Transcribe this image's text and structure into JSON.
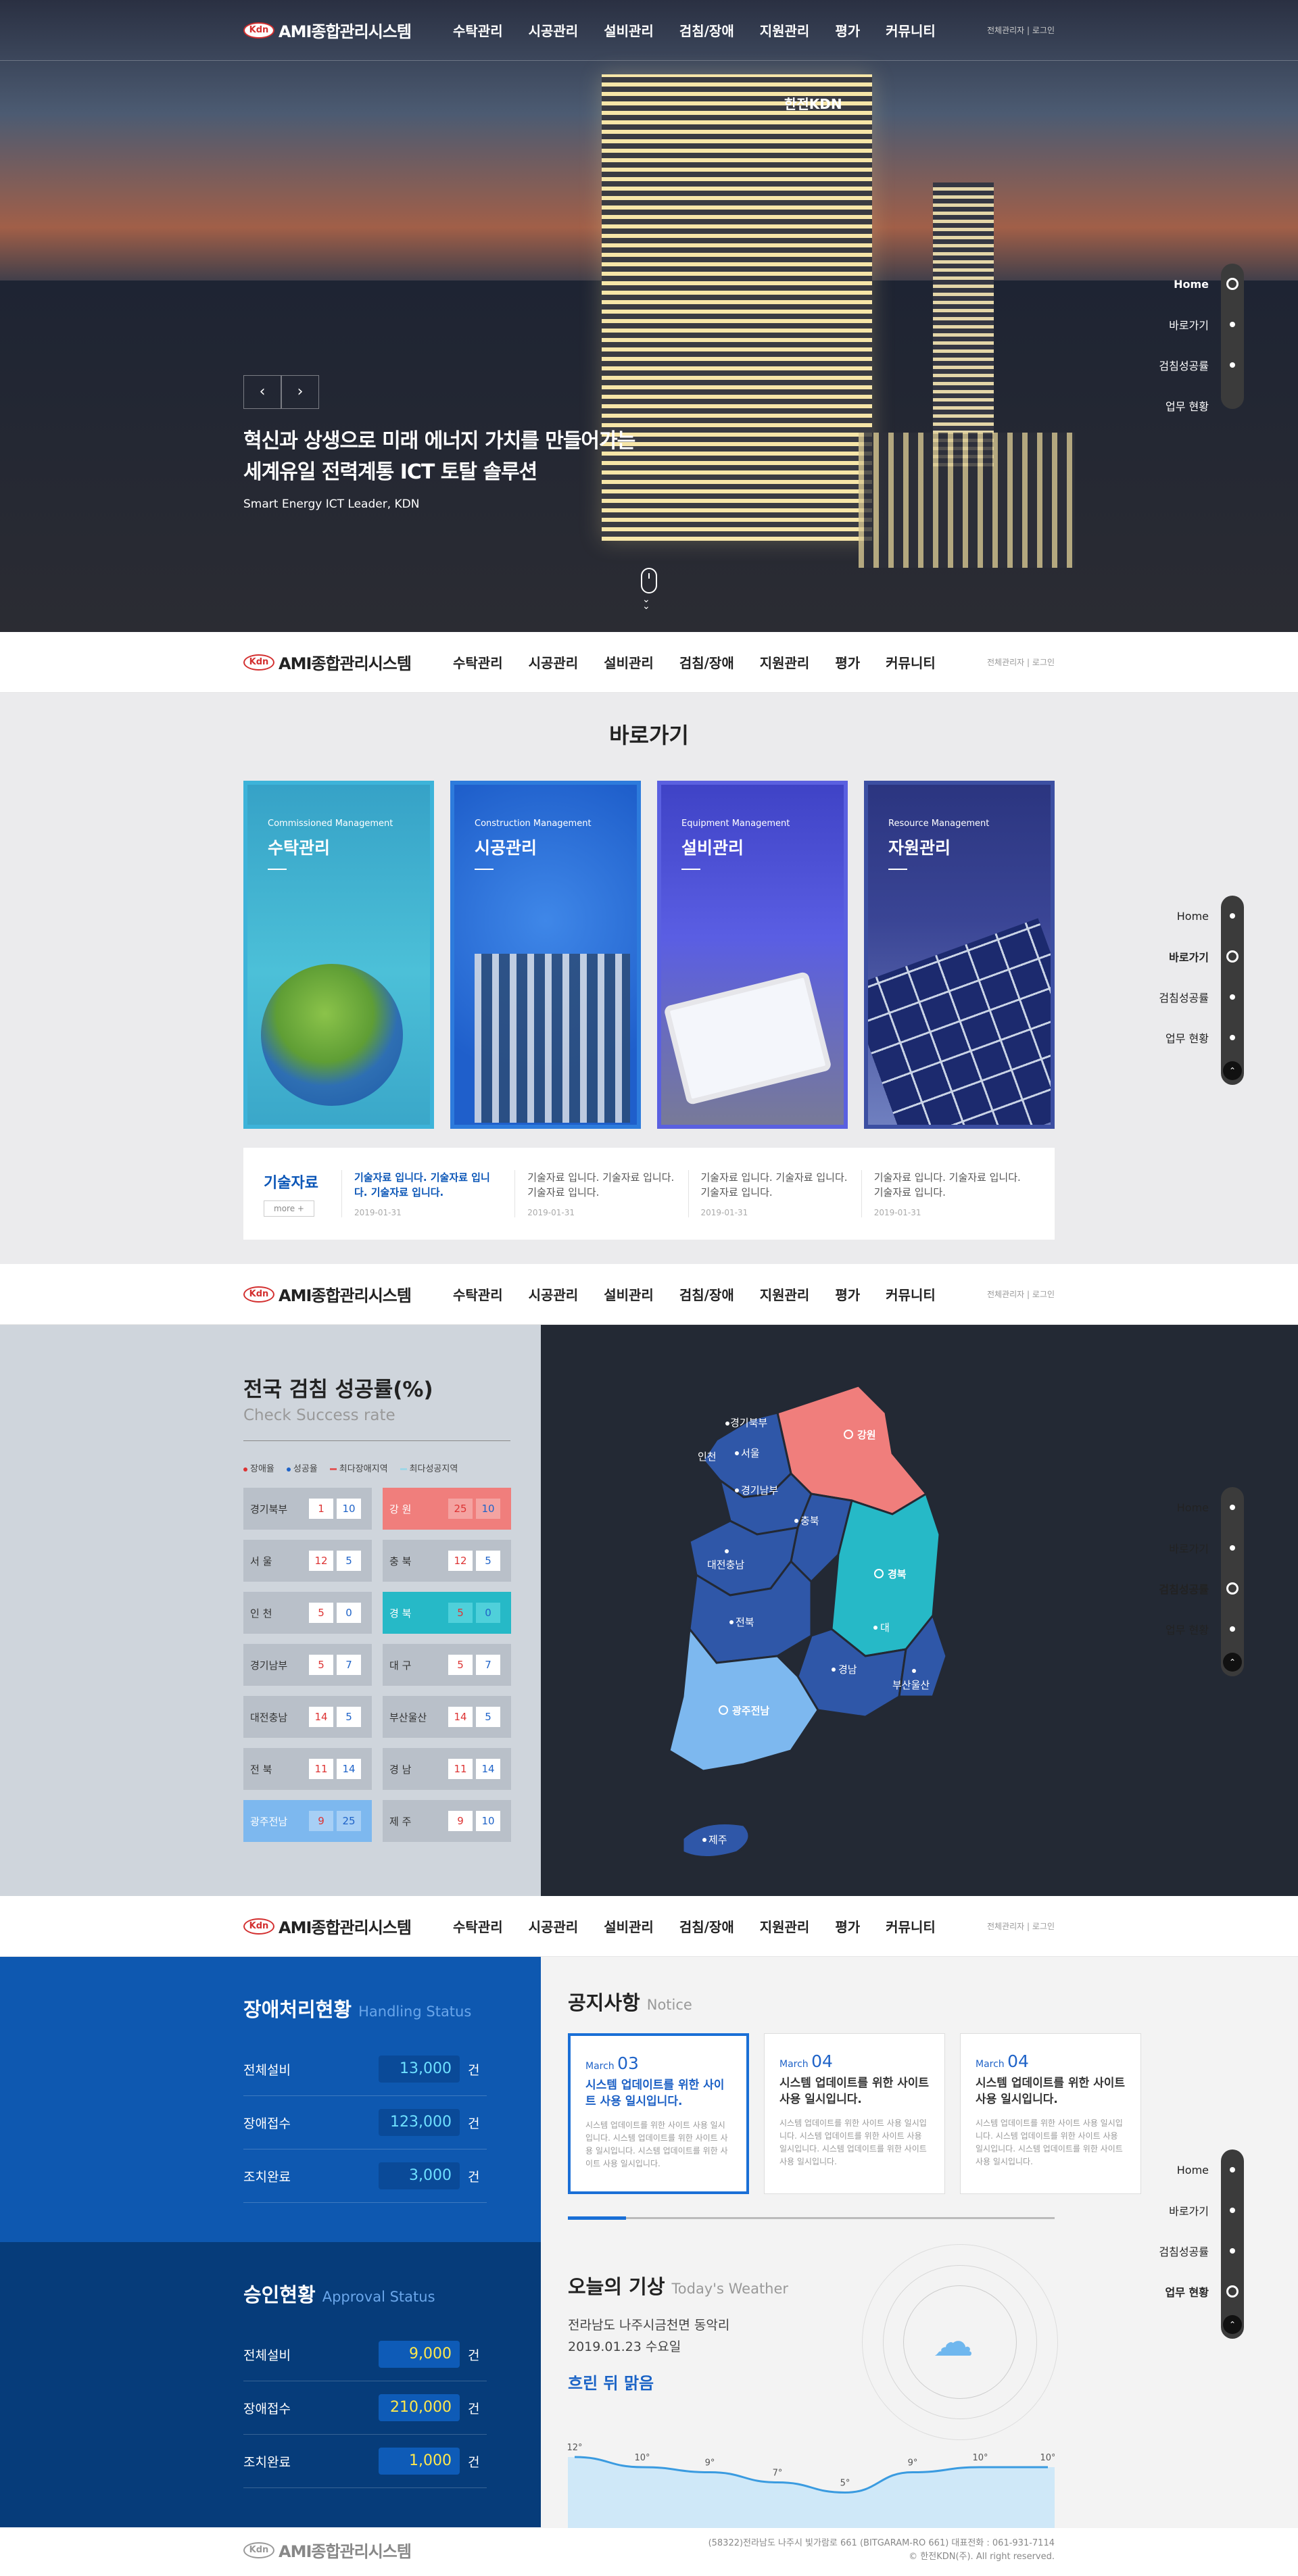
{
  "header": {
    "logo_mark": "Kdn",
    "logo_text": "AMI종합관리시스템",
    "menu": [
      "수탁관리",
      "시공관리",
      "설비관리",
      "검침/장애",
      "지원관리",
      "평가",
      "커뮤니티"
    ],
    "util": "전체관리자 | 로그인"
  },
  "sidenav": {
    "items": [
      "Home",
      "바로가기",
      "검침성공률",
      "업무 현황"
    ]
  },
  "hero": {
    "sign": "한전KDN",
    "headline_1": "혁신과 상생으로 미래 에너지 가치를 만들어가는",
    "headline_2": "세계유일 전력계통 ICT 토탈 솔루션",
    "sub": "Smart Energy ICT Leader, KDN",
    "prev": "‹",
    "next": "›"
  },
  "quick": {
    "title": "바로가기",
    "cards": [
      {
        "en": "Commissioned Management",
        "ko": "수탁관리"
      },
      {
        "en": "Construction Management",
        "ko": "시공관리"
      },
      {
        "en": "Equipment Management",
        "ko": "설비관리"
      },
      {
        "en": "Resource Management",
        "ko": "자원관리"
      }
    ],
    "tech": {
      "label": "기술자료",
      "more": "more +",
      "items": [
        {
          "text": "기술자료 입니다. 기술자료 입니다. 기술자료 입니다.",
          "date": "2019-01-31"
        },
        {
          "text": "기술자료 입니다. 기술자료 입니다. 기술자료 입니다.",
          "date": "2019-01-31"
        },
        {
          "text": "기술자료 입니다. 기술자료 입니다. 기술자료 입니다.",
          "date": "2019-01-31"
        },
        {
          "text": "기술자료 입니다. 기술자료 입니다. 기술자료 입니다.",
          "date": "2019-01-31"
        }
      ]
    }
  },
  "check": {
    "title": "전국 검침 성공률(%)",
    "subtitle": "Check Success rate",
    "legend": [
      "장애율",
      "성공율",
      "최다장애지역",
      "최다성공지역"
    ],
    "legend_colors": [
      "#d33",
      "#1f63c8",
      "#e05a5a",
      "#9fd6e6"
    ],
    "regions": [
      {
        "name": "경기북부",
        "a": "1",
        "b": "10",
        "style": ""
      },
      {
        "name": "강    원",
        "a": "25",
        "b": "10",
        "style": "red"
      },
      {
        "name": "서    울",
        "a": "12",
        "b": "5",
        "style": ""
      },
      {
        "name": "충    북",
        "a": "12",
        "b": "5",
        "style": ""
      },
      {
        "name": "인    천",
        "a": "5",
        "b": "0",
        "style": ""
      },
      {
        "name": "경    북",
        "a": "5",
        "b": "0",
        "style": "teal"
      },
      {
        "name": "경기남부",
        "a": "5",
        "b": "7",
        "style": ""
      },
      {
        "name": "대    구",
        "a": "5",
        "b": "7",
        "style": ""
      },
      {
        "name": "대전충남",
        "a": "14",
        "b": "5",
        "style": ""
      },
      {
        "name": "부산울산",
        "a": "14",
        "b": "5",
        "style": ""
      },
      {
        "name": "전    북",
        "a": "11",
        "b": "14",
        "style": ""
      },
      {
        "name": "경    남",
        "a": "11",
        "b": "14",
        "style": ""
      },
      {
        "name": "광주전남",
        "a": "9",
        "b": "25",
        "style": "blue"
      },
      {
        "name": "제    주",
        "a": "9",
        "b": "10",
        "style": ""
      }
    ],
    "map_labels": {
      "gyeonggi_n": "경기북부",
      "seoul": "서울",
      "incheon": "인천",
      "gangwon": "강원",
      "gyeonggi_s": "경기남부",
      "chungbuk": "충북",
      "daejeon": "대전충남",
      "gyeongbuk": "경북",
      "daegu": "대",
      "jeonbuk": "전북",
      "gyeongnam": "경남",
      "busan": "부산울산",
      "gwangju": "광주전남",
      "jeju": "제주"
    },
    "map_colors": {
      "base": "#2f57a8",
      "red": "#f07e7c",
      "teal": "#26b9c7",
      "light": "#7db8ef"
    }
  },
  "status": {
    "failure": {
      "title": "장애처리현황",
      "title_en": "Handling Status",
      "rows": [
        {
          "k": "전체설비",
          "v": "13,000",
          "u": "건"
        },
        {
          "k": "장애접수",
          "v": "123,000",
          "u": "건"
        },
        {
          "k": "조치완료",
          "v": "3,000",
          "u": "건"
        }
      ]
    },
    "approval": {
      "title": "승인현황",
      "title_en": "Approval Status",
      "rows": [
        {
          "k": "전체설비",
          "v": "9,000",
          "u": "건"
        },
        {
          "k": "장애접수",
          "v": "210,000",
          "u": "건"
        },
        {
          "k": "조치완료",
          "v": "1,000",
          "u": "건"
        }
      ]
    }
  },
  "notice": {
    "title": "공지사항",
    "title_en": "Notice",
    "progress": 0.12,
    "cards": [
      {
        "month": "March",
        "day": "03",
        "title": "시스템 업데이트를 위한 사이트 사용 일시입니다.",
        "body": "시스템 업데이트를 위한 사이트 사용 일시입니다. 시스템 업데이트를 위한 사이트 사용 일시입니다. 시스템 업데이트를 위한 사이트 사용 일시입니다."
      },
      {
        "month": "March",
        "day": "04",
        "title": "시스템 업데이트를 위한 사이트 사용 일시입니다.",
        "body": "시스템 업데이트를 위한 사이트 사용 일시입니다. 시스템 업데이트를 위한 사이트 사용 일시입니다. 시스템 업데이트를 위한 사이트 사용 일시입니다."
      },
      {
        "month": "March",
        "day": "04",
        "title": "시스템 업데이트를 위한 사이트 사용 일시입니다.",
        "body": "시스템 업데이트를 위한 사이트 사용 일시입니다. 시스템 업데이트를 위한 사이트 사용 일시입니다. 시스템 업데이트를 위한 사이트 사용 일시입니다."
      }
    ]
  },
  "weather": {
    "title": "오늘의 기상",
    "title_en": "Today's Weather",
    "location": "전라남도 나주시금천면 동악리",
    "date": "2019.01.23 수요일",
    "condition": "흐린 뒤 맑음",
    "icon": "partly-cloudy-icon",
    "temps": [
      "12°",
      "10°",
      "9°",
      "7°",
      "5°",
      "9°",
      "10°",
      "10°"
    ],
    "temp_values": [
      12,
      10,
      9,
      7,
      5,
      9,
      10,
      10
    ]
  },
  "footer": {
    "address": "(58322)전라남도 나주시 빛가람로 661 (BITGARAM-RO 661) 대표전화 : 061-931-7114",
    "copyright": "© 한전KDN(주). All right reserved."
  }
}
